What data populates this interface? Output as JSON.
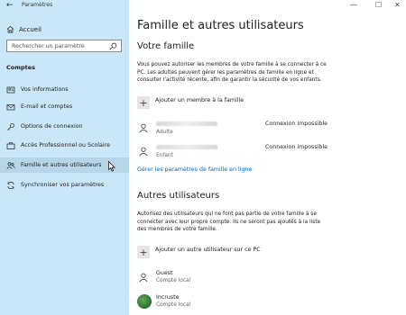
{
  "window": {
    "app_title": "Paramètres",
    "minimize": "—",
    "maximize": "☐",
    "close": "✕"
  },
  "sidebar": {
    "home_label": "Accueil",
    "search_placeholder": "Rechercher un paramètre",
    "section": "Comptes",
    "items": [
      {
        "label": "Vos informations",
        "icon": "person-card-icon"
      },
      {
        "label": "E-mail et comptes",
        "icon": "mail-icon"
      },
      {
        "label": "Options de connexion",
        "icon": "key-icon"
      },
      {
        "label": "Accès Professionnel ou Scolaire",
        "icon": "briefcase-icon"
      },
      {
        "label": "Famille et autres utilisateurs",
        "icon": "people-icon",
        "active": true
      },
      {
        "label": "Synchroniser vos paramètres",
        "icon": "sync-icon"
      }
    ]
  },
  "main": {
    "title": "Famille et autres utilisateurs",
    "family": {
      "heading": "Votre famille",
      "description_lines": [
        "Vous pouvez autoriser les membres de votre famille à se connecter à ce",
        "PC. Les adultes peuvent gérer les paramètres de famille en ligne et",
        "consulter l'activité récente, afin de garantir la sécurité de vos enfants."
      ],
      "add_label": "Ajouter un membre à la famille",
      "members": [
        {
          "role": "Adulte",
          "status": "Connexion impossible"
        },
        {
          "role": "Enfant",
          "status": "Connexion impossible"
        }
      ],
      "manage_link": "Gérer les paramètres de famille en ligne"
    },
    "others": {
      "heading": "Autres utilisateurs",
      "description_lines": [
        "Autorisez des utilisateurs qui ne font pas partie de votre famille à se",
        "connecter avec leur propre compte. Ils ne seront pas ajoutés à la liste",
        "des membres de votre famille."
      ],
      "add_label": "Ajouter un autre utilisateur sur ce PC",
      "users": [
        {
          "name": "Guest",
          "type": "Compte local"
        },
        {
          "name": "Incruste",
          "type": "Compte local"
        }
      ]
    }
  }
}
